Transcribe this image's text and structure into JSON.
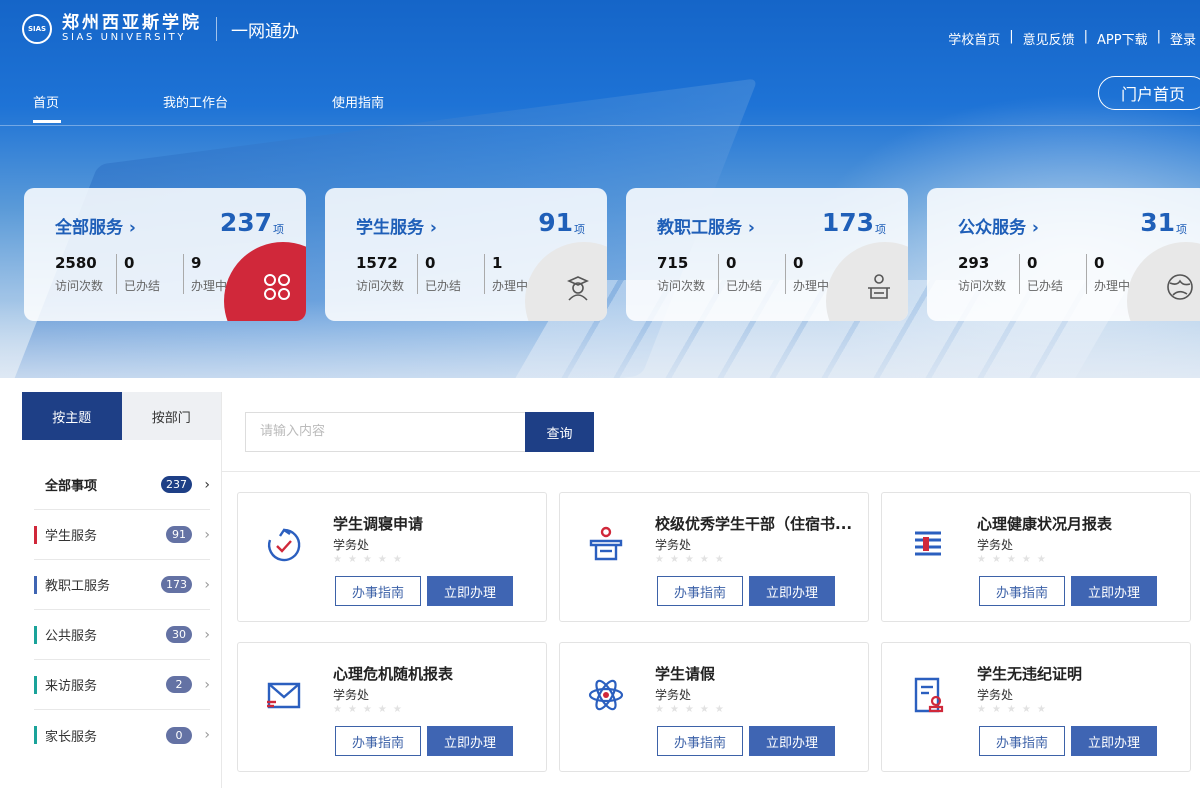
{
  "brand": {
    "seal": "SIAS",
    "name_cn": "郑州西亚斯学院",
    "name_en": "SIAS UNIVERSITY",
    "subtitle": "一网通办"
  },
  "top_links": [
    "学校首页",
    "意见反馈",
    "APP下载",
    "登录"
  ],
  "top_link_sep": "|",
  "nav": [
    "首页",
    "我的工作台",
    "使用指南"
  ],
  "portal_button": "门户首页",
  "summary_cards": [
    {
      "title": "全部服务 ›",
      "count": "237",
      "unit": "项",
      "visits": "2580",
      "visits_label": "访问次数",
      "done": "0",
      "done_label": "已办结",
      "doing": "9",
      "doing_label": "办理中",
      "icon": "apps-grid-icon",
      "accent": "#d0283a"
    },
    {
      "title": "学生服务 ›",
      "count": "91",
      "unit": "项",
      "visits": "1572",
      "visits_label": "访问次数",
      "done": "0",
      "done_label": "已办结",
      "doing": "1",
      "doing_label": "办理中",
      "icon": "graduate-icon"
    },
    {
      "title": "教职工服务 ›",
      "count": "173",
      "unit": "项",
      "visits": "715",
      "visits_label": "访问次数",
      "done": "0",
      "done_label": "已办结",
      "doing": "0",
      "doing_label": "办理中",
      "icon": "teacher-icon"
    },
    {
      "title": "公众服务 ›",
      "count": "31",
      "unit": "项",
      "visits": "293",
      "visits_label": "访问次数",
      "done": "0",
      "done_label": "已办结",
      "doing": "0",
      "doing_label": "办理中",
      "icon": "globe-icon"
    }
  ],
  "left_tabs": [
    "按主题",
    "按部门"
  ],
  "categories": [
    {
      "label": "全部事项",
      "count": "237",
      "color": ""
    },
    {
      "label": "学生服务",
      "count": "91",
      "color": "#d0283a"
    },
    {
      "label": "教职工服务",
      "count": "173",
      "color": "#3f65b3"
    },
    {
      "label": "公共服务",
      "count": "30",
      "color": "#1aa39a"
    },
    {
      "label": "来访服务",
      "count": "2",
      "color": "#1aa39a"
    },
    {
      "label": "家长服务",
      "count": "0",
      "color": "#1aa39a"
    }
  ],
  "search": {
    "placeholder": "请输入内容",
    "button": "查询"
  },
  "services": [
    {
      "title": "学生调寝申请",
      "dept": "学务处",
      "icon": "clock-check-icon"
    },
    {
      "title": "校级优秀学生干部（住宿书...",
      "dept": "学务处",
      "icon": "podium-icon"
    },
    {
      "title": "心理健康状况月报表",
      "dept": "学务处",
      "icon": "report-list-icon"
    },
    {
      "title": "心理危机随机报表",
      "dept": "学务处",
      "icon": "mail-icon"
    },
    {
      "title": "学生请假",
      "dept": "学务处",
      "icon": "atom-icon"
    },
    {
      "title": "学生无违纪证明",
      "dept": "学务处",
      "icon": "certificate-icon"
    }
  ],
  "service_buttons": {
    "guide": "办事指南",
    "apply": "立即办理"
  },
  "stars": "★★★★★"
}
